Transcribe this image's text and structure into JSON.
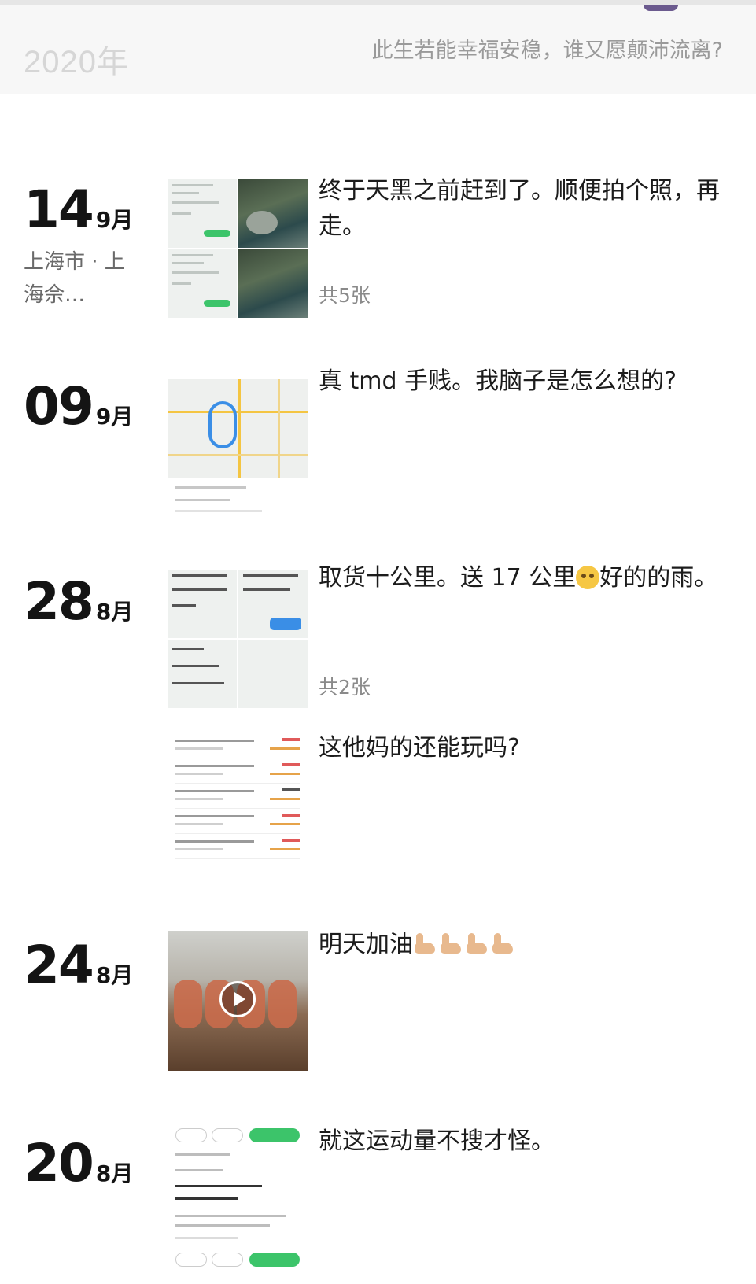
{
  "header": {
    "year": "2020年",
    "signature": "此生若能幸福安稳，谁又愿颠沛流离?"
  },
  "posts": [
    {
      "day": "14",
      "month": "9月",
      "location": "上海市 · 上海佘…",
      "text": "终于天黑之前赶到了。顺便拍个照，再走。",
      "count": "共5张",
      "thumb_icon": "photo-grid-icon"
    },
    {
      "day": "09",
      "month": "9月",
      "text": "真 tmd 手贱。我脑子是怎么想的?",
      "thumb_icon": "map-screenshot-icon"
    },
    {
      "day": "28",
      "month": "8月",
      "text": "取货十公里。送 17 公里",
      "text_after_emoji": "好的的雨。",
      "count": "共2张",
      "thumb_icon": "app-screenshot-icon"
    },
    {
      "text": "这他妈的还能玩吗?",
      "thumb_icon": "earnings-list-icon"
    },
    {
      "day": "24",
      "month": "8月",
      "text": "明天加油",
      "thumb_icon": "video-play-icon"
    },
    {
      "day": "20",
      "month": "8月",
      "text": "就这运动量不搜才怪。",
      "thumb_icon": "order-screenshot-icon"
    }
  ],
  "colors": {
    "accent_green": "#3cc46a",
    "map_route": "#3a8ee6",
    "negative": "#e05a5a"
  }
}
